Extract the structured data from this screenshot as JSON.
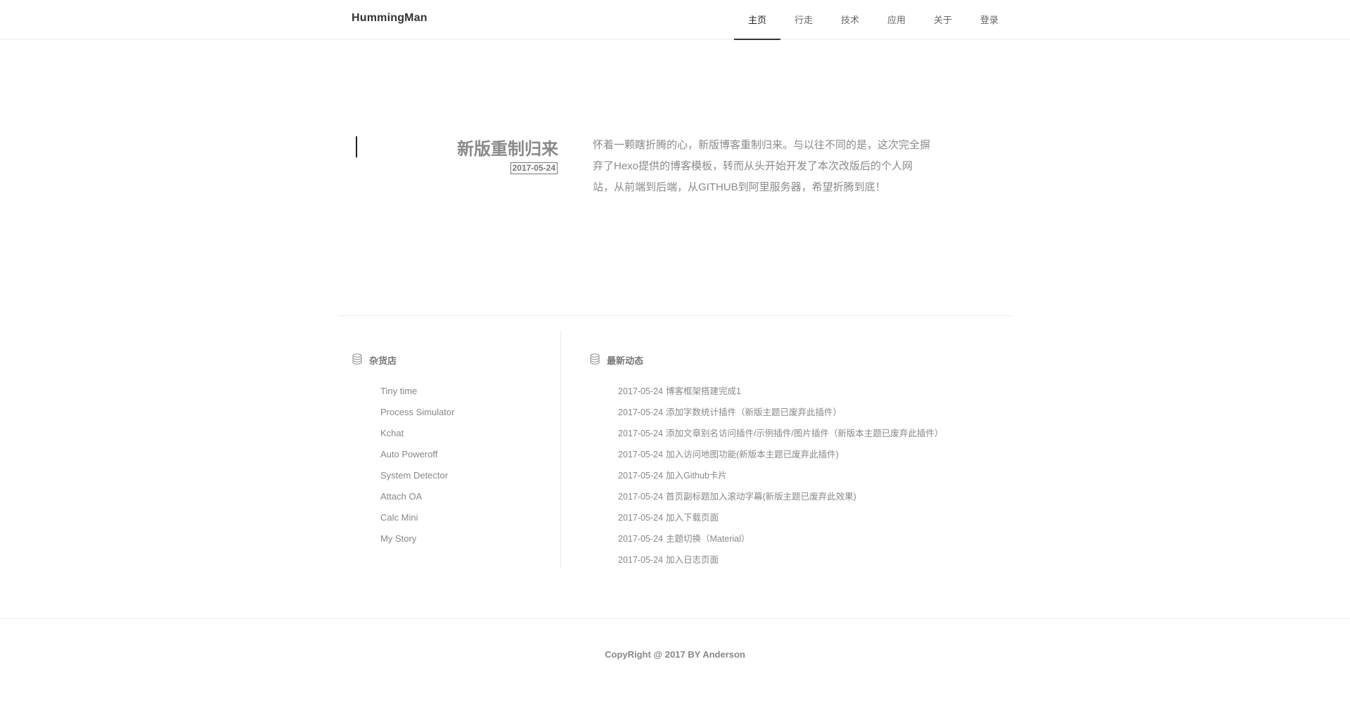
{
  "header": {
    "brand": "HummingMan",
    "nav": [
      "主页",
      "行走",
      "技术",
      "应用",
      "关于",
      "登录"
    ]
  },
  "post": {
    "title": "新版重制归来",
    "date": "2017-05-24",
    "summary": "怀着一颗瞎折腾的心，新版博客重制归来。与以往不同的是，这次完全摒弃了Hexo提供的博客模板，转而从头开始开发了本次改版后的个人网站，从前端到后端，从GITHUB到阿里服务器，希望折腾到底！"
  },
  "shop": {
    "title": "杂货店",
    "icon": "database-icon",
    "items": [
      "Tiny time",
      "Process Simulator",
      "Kchat",
      "Auto Poweroff",
      "System Detector",
      "Attach OA",
      "Calc Mini",
      "My Story"
    ]
  },
  "news": {
    "title": "最新动态",
    "icon": "database-icon",
    "items": [
      {
        "date": "2017-05-24",
        "text": "博客框架搭建完成1"
      },
      {
        "date": "2017-05-24",
        "text": "添加字数统计插件（新版主题已废弃此插件）"
      },
      {
        "date": "2017-05-24",
        "text": "添加文章别名访问插件/示例插件/图片插件（新版本主题已废弃此插件）"
      },
      {
        "date": "2017-05-24",
        "text": "加入访问地图功能(新版本主题已废弃此插件)"
      },
      {
        "date": "2017-05-24",
        "text": "加入Github卡片"
      },
      {
        "date": "2017-05-24",
        "text": "首页副标题加入滚动字幕(新版主题已废弃此效果)"
      },
      {
        "date": "2017-05-24",
        "text": "加入下载页面"
      },
      {
        "date": "2017-05-24",
        "text": "主题切换（Material）"
      },
      {
        "date": "2017-05-24",
        "text": "加入日志页面"
      }
    ]
  },
  "footer": {
    "copyright": "CopyRight @ 2017 BY Anderson"
  }
}
